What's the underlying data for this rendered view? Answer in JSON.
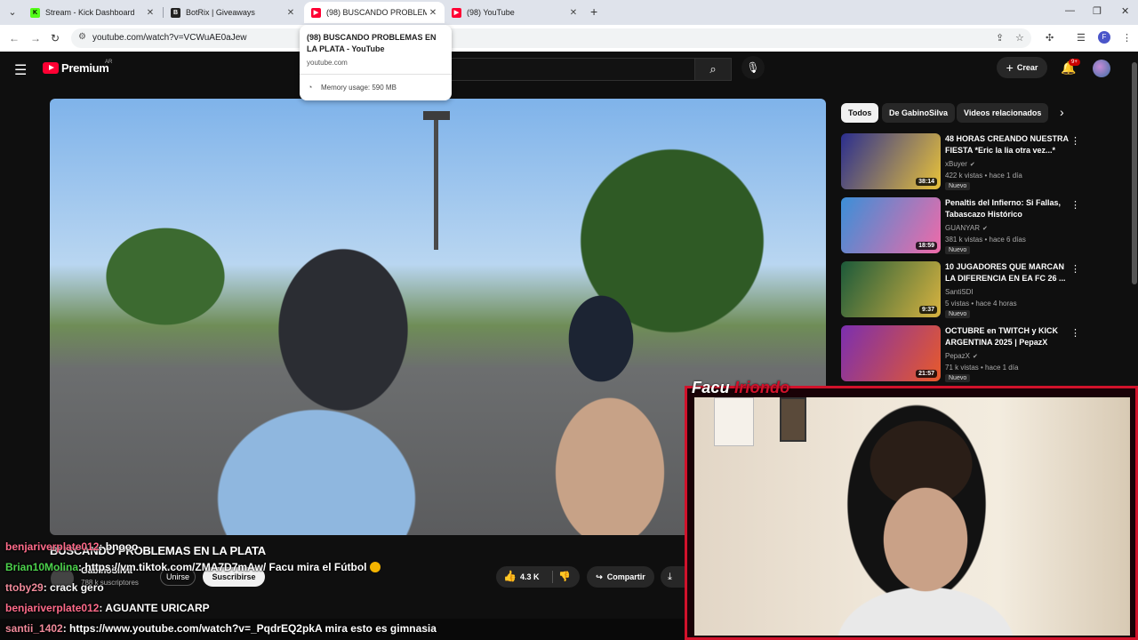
{
  "browser": {
    "tabs": [
      {
        "title": "Stream - Kick Dashboard",
        "favicon": "kick-icon",
        "color": "#53fc18",
        "active": false
      },
      {
        "title": "BotRix | Giveaways",
        "favicon": "botrix-icon",
        "color": "#222222",
        "active": false
      },
      {
        "title": "(98) BUSCANDO PROBLEMAS E",
        "favicon": "youtube-icon",
        "color": "#ff0033",
        "active": true
      },
      {
        "title": "(98) YouTube",
        "favicon": "youtube-icon",
        "color": "#ff0033",
        "active": false
      }
    ],
    "url": "youtube.com/watch?v=VCWuAE0aJew",
    "profile_initial": "F",
    "hover_card": {
      "title": "(98) BUSCANDO PROBLEMAS EN LA PLATA - YouTube",
      "domain": "youtube.com",
      "memory": "Memory usage: 590 MB"
    }
  },
  "youtube": {
    "logo_text": "Premium",
    "region": "AR",
    "create_label": "Crear",
    "notification_count": "9+",
    "video": {
      "title": "BUSCANDO PROBLEMAS EN LA PLATA",
      "channel": "GabinoSilva",
      "subscribers": "788 k suscriptores",
      "join_label": "Unirse",
      "subscribe_label": "Suscribirse",
      "likes": "4.3 K",
      "share_label": "Compartir"
    },
    "chips": [
      "Todos",
      "De GabinoSilva",
      "Videos relacionados"
    ],
    "recommendations": [
      {
        "title": "48 HORAS CREANDO NUESTRA FIESTA *Eric la lia otra vez...*",
        "channel": "xBuyer",
        "meta": "422 k vistas • hace 1 día",
        "duration": "38:14",
        "badge": "Nuevo",
        "thumb_a": "#2b2e8f",
        "thumb_b": "#e8c23a"
      },
      {
        "title": "Penaltis del Infierno: Si Fallas, Tabascazo Histórico",
        "channel": "GUANYAR",
        "meta": "381 k vistas • hace 6 días",
        "duration": "18:59",
        "badge": "Nuevo",
        "thumb_a": "#3b8fd8",
        "thumb_b": "#f06aa8"
      },
      {
        "title": "10 JUGADORES QUE MARCAN LA DIFERENCIA EN EA FC 26 ...",
        "channel": "SantiSDI",
        "meta": "5 vistas • hace 4 horas",
        "duration": "9:37",
        "badge": "Nuevo",
        "thumb_a": "#1c5a3a",
        "thumb_b": "#d8b340"
      },
      {
        "title": "OCTUBRE en TWITCH y KICK ARGENTINA 2025 | PepazX",
        "channel": "PepazX",
        "meta": "71 k vistas • hace 1 día",
        "duration": "21:57",
        "badge": "Nuevo",
        "thumb_a": "#7b2fb0",
        "thumb_b": "#e85a2a"
      }
    ]
  },
  "stream_overlay": {
    "cam_logo_a": "Facu",
    "cam_logo_b": "Iriondo",
    "accent_color": "#d1122b",
    "chat": [
      {
        "user": "benjariverplate012",
        "message": ": bnooo",
        "color": "#ff6b8a"
      },
      {
        "user": "Brian10Molina",
        "message": ": https://vm.tiktok.com/ZMA7D7mAw/ Facu mira el Fútbol",
        "color": "#4cd24c"
      },
      {
        "user": "ttoby29",
        "message": ": crack gero",
        "color": "#f08a9a"
      },
      {
        "user": "benjariverplate012",
        "message": ": AGUANTE URICARP",
        "color": "#ff6b8a"
      },
      {
        "user": "santii_1402",
        "message": ": https://www.youtube.com/watch?v=_PqdrEQ2pkA mira esto es gimnasia",
        "color": "#ff6b8a"
      }
    ]
  }
}
